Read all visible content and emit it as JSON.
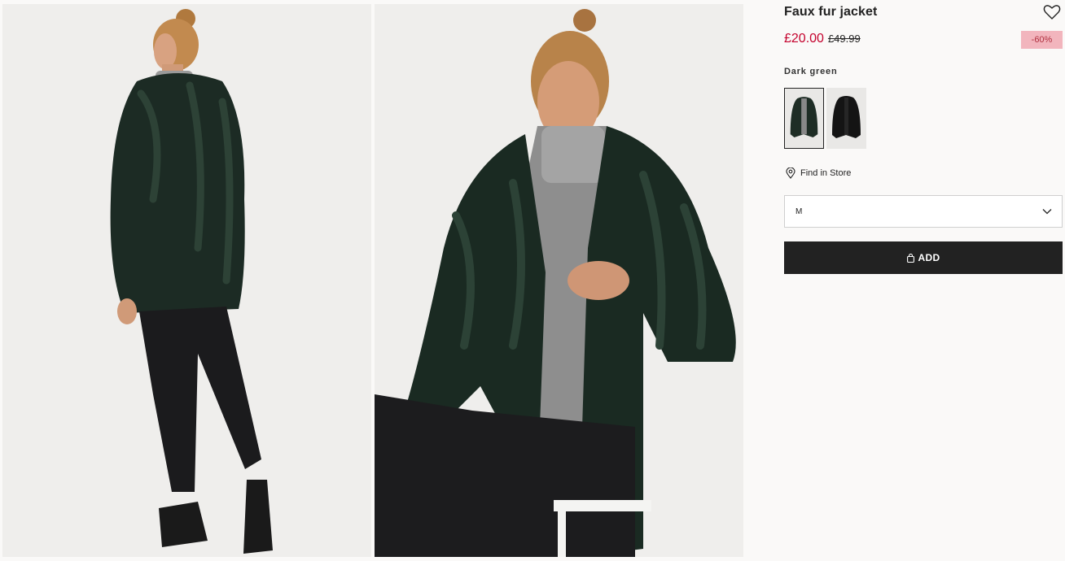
{
  "product": {
    "name": "Faux fur jacket",
    "price_current": "£20.00",
    "price_original": "£49.99",
    "discount_badge": "-60%",
    "color_label": "Dark green"
  },
  "swatches": [
    {
      "name": "Dark green",
      "selected": true
    },
    {
      "name": "Black",
      "selected": false
    }
  ],
  "actions": {
    "find_in_store": "Find in Store",
    "size_selected": "M",
    "add_button": "ADD"
  },
  "icons": {
    "favorite": "heart-icon",
    "store": "location-pin-icon",
    "dropdown": "chevron-down-icon",
    "bag": "shopping-bag-icon"
  },
  "colors": {
    "sale_price": "#c4022d",
    "badge_bg": "#f2b5bd",
    "button_bg": "#222222",
    "background": "#faf9f8"
  }
}
